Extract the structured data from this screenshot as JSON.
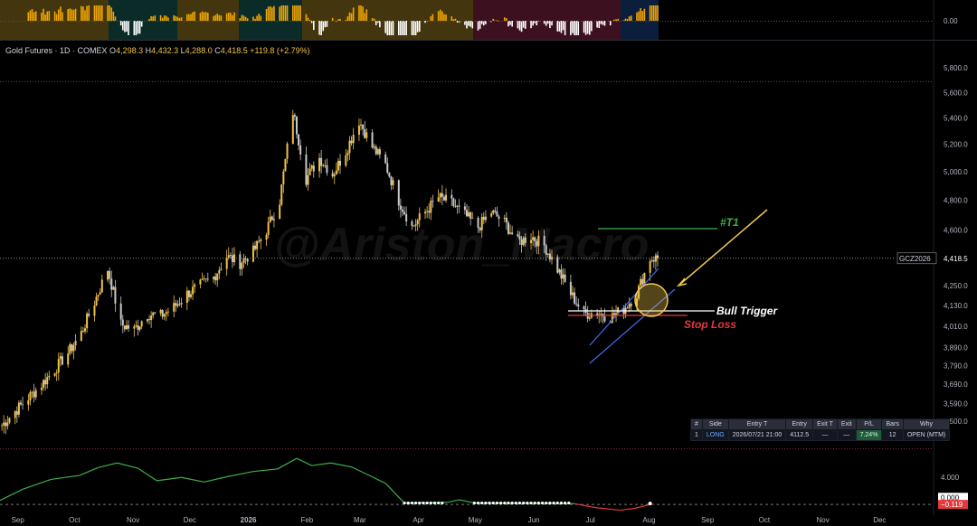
{
  "header": {
    "symbol_label": "Gold Futures · 1D · COMEX",
    "open_label": "O",
    "open_value": "4,298.3",
    "high_label": "H",
    "high_value": "4,432.3",
    "low_label": "L",
    "low_value": "4,288.0",
    "close_label": "C",
    "close_value": "4,418.5",
    "change": "+119.8 (+2.79%)"
  },
  "watermark": "@Ariston_Macro",
  "price_tag": {
    "symbol": "GCZ2026",
    "price": "4,418.5"
  },
  "colors": {
    "bg": "#000000",
    "candle_up": "#f0c24a",
    "candle_down": "#c8c8c8",
    "channel": "#3d6cf5",
    "target": "#3fae49",
    "trigger": "#ffffff",
    "stop": "#e5383b",
    "arrow": "#f2c94c",
    "osc_up": "#3fae49",
    "osc_down": "#e5383b"
  },
  "annotations": {
    "target_label": "#T1",
    "target_price": 4570,
    "trigger_label": "Bull Trigger",
    "trigger_price": 4112.5,
    "stop_label": "Stop Loss",
    "stop_price": 4088
  },
  "trade_table": {
    "columns": [
      "#",
      "Side",
      "Entry T",
      "Entry",
      "Exit T",
      "Exit",
      "P/L",
      "Bars",
      "Why"
    ],
    "rows": [
      [
        "1",
        "LONG",
        "2026/07/21 21:00",
        "4112.5",
        "—",
        "—",
        "7.24%",
        "12",
        "OPEN (MTM)"
      ]
    ]
  },
  "chart_data": [
    {
      "type": "bar",
      "panel": "top-histogram",
      "ylabel_ticks": [
        "0.00"
      ],
      "zero_value": 0.0,
      "regime_colors": [
        "#5a4712",
        "#0f3a35",
        "#5a4712",
        "#0f3a35",
        "#5a4712",
        "#52162a",
        "#0f2a52"
      ]
    },
    {
      "type": "line",
      "panel": "price",
      "title": "Gold Futures · 1D · COMEX",
      "scale": "log",
      "ylim": [
        3420,
        5900
      ],
      "y_ticks": [
        "5,800.0",
        "5,600.0",
        "5,400.0",
        "5,200.0",
        "5,000.0",
        "4,800.0",
        "4,600.0",
        "4,418.5",
        "4,250.0",
        "4,130.0",
        "4,010.0",
        "3,890.0",
        "3,790.0",
        "3,690.0",
        "3,590.0",
        "3,500.0"
      ],
      "y_tick_values": [
        5800,
        5600,
        5400,
        5200,
        5000,
        4800,
        4600,
        4418.5,
        4250,
        4130,
        4010,
        3890,
        3790,
        3690,
        3590,
        3500
      ],
      "x_ticks": [
        "Sep",
        "Oct",
        "Nov",
        "Dec",
        "2026",
        "Feb",
        "Mar",
        "Apr",
        "May",
        "Jun",
        "Jul",
        "Aug",
        "Sep",
        "Oct",
        "Nov",
        "Dec"
      ],
      "x_tick_dates": [
        "2025-09-01",
        "2025-10-01",
        "2025-11-01",
        "2025-12-01",
        "2026-01-01",
        "2026-02-01",
        "2026-03-01",
        "2026-04-01",
        "2026-05-01",
        "2026-06-01",
        "2026-07-01",
        "2026-08-01",
        "2026-09-01",
        "2026-10-01",
        "2026-11-01",
        "2026-12-01"
      ],
      "x_range": [
        "2025-08-24",
        "2026-12-31"
      ],
      "series": [
        {
          "points": [
            [
              "2025-08-25",
              3480
            ],
            [
              "2025-09-01",
              3550
            ],
            [
              "2025-09-08",
              3620
            ],
            [
              "2025-09-15",
              3690
            ],
            [
              "2025-09-22",
              3770
            ],
            [
              "2025-09-29",
              3860
            ],
            [
              "2025-10-06",
              3970
            ],
            [
              "2025-10-13",
              4150
            ],
            [
              "2025-10-20",
              4350
            ],
            [
              "2025-10-27",
              4020
            ],
            [
              "2025-11-03",
              3990
            ],
            [
              "2025-11-10",
              4080
            ],
            [
              "2025-11-17",
              4070
            ],
            [
              "2025-11-24",
              4120
            ],
            [
              "2025-12-01",
              4200
            ],
            [
              "2025-12-08",
              4250
            ],
            [
              "2025-12-15",
              4300
            ],
            [
              "2025-12-22",
              4430
            ],
            [
              "2025-12-29",
              4390
            ],
            [
              "2026-01-05",
              4460
            ],
            [
              "2026-01-12",
              4600
            ],
            [
              "2026-01-19",
              4800
            ],
            [
              "2026-01-26",
              5450
            ],
            [
              "2026-02-02",
              4950
            ],
            [
              "2026-02-09",
              5100
            ],
            [
              "2026-02-16",
              4980
            ],
            [
              "2026-02-23",
              5150
            ],
            [
              "2026-03-02",
              5380
            ],
            [
              "2026-03-09",
              5180
            ],
            [
              "2026-03-16",
              5050
            ],
            [
              "2026-03-23",
              4800
            ],
            [
              "2026-03-30",
              4620
            ],
            [
              "2026-04-06",
              4720
            ],
            [
              "2026-04-13",
              4820
            ],
            [
              "2026-04-20",
              4780
            ],
            [
              "2026-04-27",
              4700
            ],
            [
              "2026-05-04",
              4620
            ],
            [
              "2026-05-11",
              4720
            ],
            [
              "2026-05-18",
              4650
            ],
            [
              "2026-05-25",
              4520
            ],
            [
              "2026-06-01",
              4560
            ],
            [
              "2026-06-08",
              4500
            ],
            [
              "2026-06-15",
              4350
            ],
            [
              "2026-06-22",
              4200
            ],
            [
              "2026-06-29",
              4080
            ],
            [
              "2026-07-06",
              4090
            ],
            [
              "2026-07-13",
              4060
            ],
            [
              "2026-07-20",
              4110
            ],
            [
              "2026-07-27",
              4200
            ],
            [
              "2026-08-03",
              4418.5
            ]
          ]
        }
      ]
    },
    {
      "type": "line",
      "panel": "oscillator",
      "y_ticks": [
        "4.000",
        "0.000",
        "−0.119"
      ],
      "y_tick_values": [
        4.0,
        0.0,
        -0.119
      ],
      "ylim": [
        -1.2,
        7.2
      ],
      "series": [
        {
          "points": [
            [
              "2025-08-24",
              0.5
            ],
            [
              "2025-09-05",
              2.2
            ],
            [
              "2025-09-20",
              3.7
            ],
            [
              "2025-10-05",
              4.3
            ],
            [
              "2025-10-15",
              5.5
            ],
            [
              "2025-10-25",
              6.2
            ],
            [
              "2025-11-05",
              5.4
            ],
            [
              "2025-11-15",
              3.5
            ],
            [
              "2025-11-28",
              4.0
            ],
            [
              "2025-12-10",
              3.3
            ],
            [
              "2025-12-22",
              4.1
            ],
            [
              "2026-01-05",
              4.9
            ],
            [
              "2026-01-18",
              5.3
            ],
            [
              "2026-01-28",
              6.9
            ],
            [
              "2026-02-05",
              5.8
            ],
            [
              "2026-02-15",
              6.2
            ],
            [
              "2026-02-26",
              5.6
            ],
            [
              "2026-03-06",
              4.5
            ],
            [
              "2026-03-16",
              3.1
            ],
            [
              "2026-03-26",
              0.1
            ],
            [
              "2026-04-18",
              0.2
            ],
            [
              "2026-04-24",
              0.6
            ],
            [
              "2026-05-02",
              0.1
            ],
            [
              "2026-06-24",
              0.0
            ],
            [
              "2026-07-05",
              -0.6
            ],
            [
              "2026-07-18",
              -1.0
            ],
            [
              "2026-07-26",
              -0.7
            ],
            [
              "2026-08-03",
              -0.119
            ]
          ]
        }
      ]
    }
  ]
}
